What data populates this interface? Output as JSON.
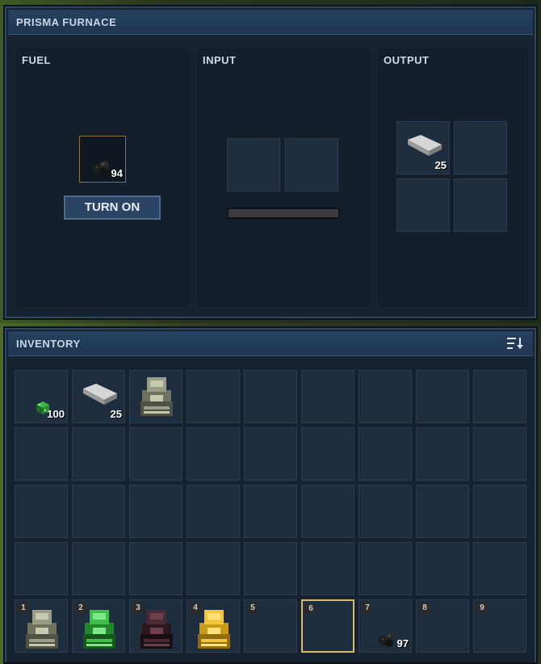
{
  "furnace": {
    "title": "PRISMA FURNACE",
    "fuel": {
      "label": "FUEL",
      "item": "coal-icon",
      "count": "94",
      "button_label": "TURN ON"
    },
    "input": {
      "label": "INPUT",
      "progress": 0
    },
    "output": {
      "label": "OUTPUT",
      "slots": [
        {
          "item": "iron-bar-icon",
          "count": "25"
        },
        null,
        null,
        null
      ]
    }
  },
  "inventory": {
    "title": "INVENTORY",
    "sort_icon": "sort-icon",
    "rows": [
      [
        {
          "item": "green-ore-icon",
          "count": "100"
        },
        {
          "item": "iron-bar-icon",
          "count": "25"
        },
        {
          "item": "stone-furnace-icon",
          "count": ""
        }
      ]
    ],
    "hotbar": [
      {
        "num": "1",
        "item": "stone-furnace-icon",
        "count": ""
      },
      {
        "num": "2",
        "item": "green-furnace-icon",
        "count": ""
      },
      {
        "num": "3",
        "item": "dark-furnace-icon",
        "count": ""
      },
      {
        "num": "4",
        "item": "gold-furnace-icon",
        "count": ""
      },
      {
        "num": "5",
        "item": "",
        "count": ""
      },
      {
        "num": "6",
        "item": "",
        "count": "",
        "selected": true
      },
      {
        "num": "7",
        "item": "coal-icon",
        "count": "97"
      },
      {
        "num": "8",
        "item": "",
        "count": ""
      },
      {
        "num": "9",
        "item": "",
        "count": ""
      }
    ]
  },
  "colors": {
    "panel": "#162230",
    "header": "#1f3650",
    "slot": "#1f2e3f",
    "selected": "#d9b96a"
  }
}
